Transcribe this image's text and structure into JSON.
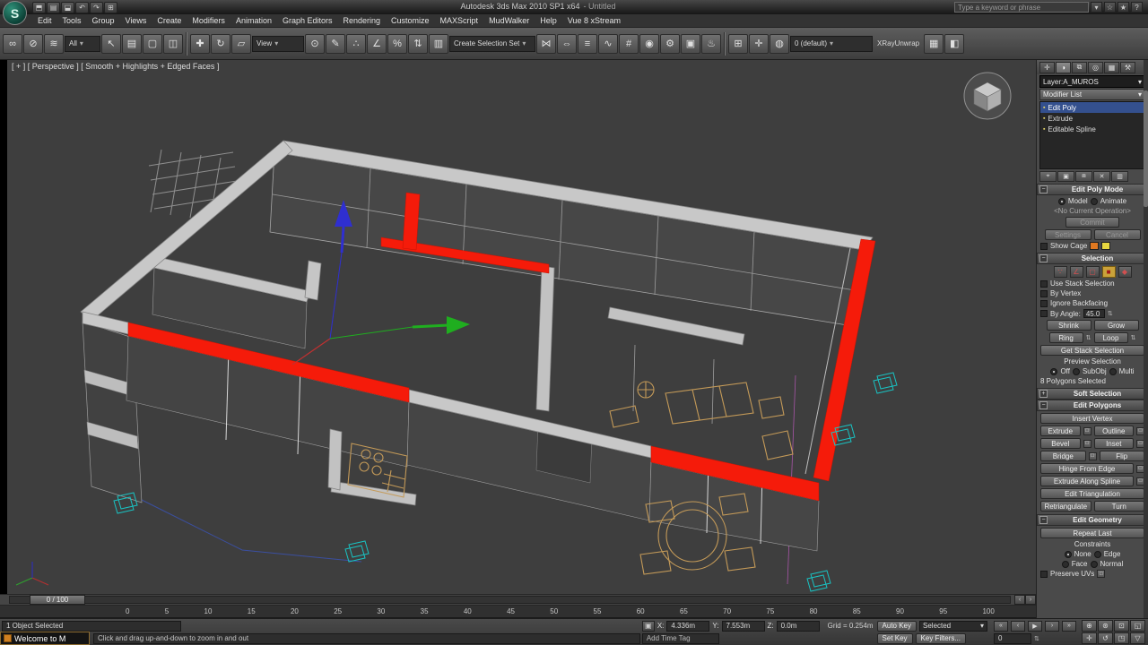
{
  "colors": {
    "selection_red": "#f51b0a",
    "gizmo_blue": "#2f2fd0",
    "gizmo_green": "#1fae1f",
    "wall_gray": "#c8c8c8",
    "furniture_tan": "#c49a58",
    "helper_teal": "#19c3c3",
    "viewport_bg": "#3e3e3e",
    "panel_bg": "#4a4a4a",
    "cage_swatch_orange": "#e07820",
    "cage_swatch_yellow": "#e8d840"
  },
  "icons": {
    "dropdown_arrow": "▾",
    "spinner": "⇅",
    "collapse": "−",
    "expand": "+",
    "mini_settings": "□",
    "lock": "▣",
    "logo_letter": "S",
    "slider_left": "‹",
    "slider_right": "›"
  },
  "titlebar": {
    "title": "Autodesk 3ds Max 2010 SP1 x64",
    "doc": "- Untitled"
  },
  "qat": {
    "icons": [
      {
        "name": "new-scene-icon",
        "glyph": "⬒"
      },
      {
        "name": "open-file-icon",
        "glyph": "▤"
      },
      {
        "name": "save-file-icon",
        "glyph": "⬓"
      },
      {
        "name": "undo-icon",
        "glyph": "↶"
      },
      {
        "name": "redo-icon",
        "glyph": "↷"
      },
      {
        "name": "project-folder-icon",
        "glyph": "⊞"
      }
    ]
  },
  "infocenter": {
    "placeholder": "Type a keyword or phrase",
    "icons": [
      {
        "name": "search-icon",
        "glyph": "▾"
      },
      {
        "name": "communication-center-icon",
        "glyph": "☆"
      },
      {
        "name": "favorites-icon",
        "glyph": "★"
      },
      {
        "name": "help-icon",
        "glyph": "?"
      }
    ]
  },
  "menubar": {
    "items": [
      "Edit",
      "Tools",
      "Group",
      "Views",
      "Create",
      "Modifiers",
      "Animation",
      "Graph Editors",
      "Rendering",
      "Customize",
      "MAXScript",
      "MudWalker",
      "Help",
      "Vue 8 xStream"
    ]
  },
  "toolbar": {
    "filter_dropdown": "All",
    "view_dropdown": "View",
    "selection_set_dropdown": "Create Selection Set",
    "layer_dropdown": "0 (default)",
    "xray_label": "XRayUnwrap",
    "icons_link": [
      {
        "name": "select-and-link-icon",
        "glyph": "∞"
      },
      {
        "name": "unlink-selection-icon",
        "glyph": "⊘"
      },
      {
        "name": "bind-to-spacewarp-icon",
        "glyph": "≋"
      }
    ],
    "icons_select": [
      {
        "name": "select-object-icon",
        "glyph": "↖"
      },
      {
        "name": "select-by-name-icon",
        "glyph": "▤"
      },
      {
        "name": "rectangular-region-icon",
        "glyph": "▢"
      },
      {
        "name": "window-crossing-icon",
        "glyph": "◫"
      }
    ],
    "icons_transform": [
      {
        "name": "select-and-move-icon",
        "glyph": "✚"
      },
      {
        "name": "select-and-rotate-icon",
        "glyph": "↻"
      },
      {
        "name": "select-and-scale-icon",
        "glyph": "▱"
      }
    ],
    "icons_snap": [
      {
        "name": "use-center-icon",
        "glyph": "⊙"
      },
      {
        "name": "select-and-manipulate-icon",
        "glyph": "✎"
      },
      {
        "name": "snap-toggle-icon",
        "glyph": "∴"
      },
      {
        "name": "angle-snap-icon",
        "glyph": "∠"
      },
      {
        "name": "percent-snap-icon",
        "glyph": "%"
      },
      {
        "name": "spinner-snap-icon",
        "glyph": "⇅"
      },
      {
        "name": "named-selection-sets-icon",
        "glyph": "▥"
      }
    ],
    "icons_tools": [
      {
        "name": "mirror-icon",
        "glyph": "⋈"
      },
      {
        "name": "align-icon",
        "glyph": "⇔"
      },
      {
        "name": "layer-manager-icon",
        "glyph": "≡"
      },
      {
        "name": "curve-editor-icon",
        "glyph": "∿"
      },
      {
        "name": "schematic-view-icon",
        "glyph": "#"
      },
      {
        "name": "material-editor-icon",
        "glyph": "◉"
      },
      {
        "name": "render-setup-icon",
        "glyph": "⚙"
      },
      {
        "name": "rendered-frame-icon",
        "glyph": "▣"
      },
      {
        "name": "render-production-icon",
        "glyph": "♨"
      }
    ],
    "icons_right": [
      {
        "name": "layers-toolbar-icon",
        "glyph": "⊞"
      },
      {
        "name": "create-layer-icon",
        "glyph": "✛"
      },
      {
        "name": "xview-icon",
        "glyph": "◍"
      }
    ],
    "icons_right2": [
      {
        "name": "unwrap-tool-icon",
        "glyph": "▦"
      },
      {
        "name": "unwrap-options-icon",
        "glyph": "◧"
      }
    ]
  },
  "viewport": {
    "label": "[ + ] [ Perspective ] [ Smooth + Highlights + Edged Faces ]",
    "time_slider": "0 / 100"
  },
  "command_panel": {
    "tabs": [
      {
        "name": "tab-create",
        "glyph": "✛"
      },
      {
        "name": "tab-modify",
        "glyph": "◑",
        "active": true
      },
      {
        "name": "tab-hierarchy",
        "glyph": "⧉"
      },
      {
        "name": "tab-motion",
        "glyph": "◎"
      },
      {
        "name": "tab-display",
        "glyph": "▦"
      },
      {
        "name": "tab-utilities",
        "glyph": "⚒"
      }
    ],
    "layer_field": "Layer:A_MUROS",
    "modifier_list": "Modifier List",
    "stack": [
      {
        "label": "Edit Poly",
        "icon": "▪",
        "selected": true
      },
      {
        "label": "Extrude",
        "icon": "▪"
      },
      {
        "label": "Editable Spline",
        "icon": "▪"
      }
    ],
    "stack_buttons": [
      {
        "name": "pin-stack-icon",
        "glyph": "⌖"
      },
      {
        "name": "show-end-result-icon",
        "glyph": "▣"
      },
      {
        "name": "make-unique-icon",
        "glyph": "⧈"
      },
      {
        "name": "remove-modifier-icon",
        "glyph": "✕"
      },
      {
        "name": "configure-modifier-sets-icon",
        "glyph": "▥"
      }
    ],
    "rollouts": {
      "edit_poly_mode": {
        "title": "Edit Poly Mode",
        "radio_model": "Model",
        "radio_animate": "Animate",
        "operation": "<No Current Operation>",
        "commit": "Commit",
        "settings": "Settings",
        "cancel": "Cancel",
        "show_cage": "Show Cage"
      },
      "selection": {
        "title": "Selection",
        "subobject_icons": [
          {
            "name": "vertex-mode-icon",
            "glyph": "∵"
          },
          {
            "name": "edge-mode-icon",
            "glyph": "∠"
          },
          {
            "name": "border-mode-icon",
            "glyph": "▢"
          },
          {
            "name": "polygon-mode-icon",
            "glyph": "■",
            "active": true
          },
          {
            "name": "element-mode-icon",
            "glyph": "◆"
          }
        ],
        "use_stack_selection": "Use Stack Selection",
        "by_vertex": "By Vertex",
        "ignore_backfacing": "Ignore Backfacing",
        "by_angle": "By Angle:",
        "by_angle_value": "45.0",
        "shrink": "Shrink",
        "grow": "Grow",
        "ring": "Ring",
        "loop": "Loop",
        "get_stack_selection": "Get Stack Selection",
        "preview_selection": "Preview Selection",
        "off": "Off",
        "subobj": "SubObj",
        "multi": "Multi",
        "status": "8 Polygons Selected"
      },
      "soft_selection": {
        "title": "Soft Selection"
      },
      "edit_polygons": {
        "title": "Edit Polygons",
        "insert_vertex": "Insert Vertex",
        "extrude": "Extrude",
        "outline": "Outline",
        "bevel": "Bevel",
        "inset": "Inset",
        "bridge": "Bridge",
        "flip": "Flip",
        "hinge_from_edge": "Hinge From Edge",
        "extrude_along_spline": "Extrude Along Spline",
        "edit_triangulation": "Edit Triangulation",
        "retriangulate": "Retriangulate",
        "turn": "Turn"
      },
      "edit_geometry": {
        "title": "Edit Geometry",
        "repeat_last": "Repeat Last",
        "constraints": "Constraints",
        "none": "None",
        "edge": "Edge",
        "face": "Face",
        "normal": "Normal",
        "preserve_uvs": "Preserve UVs"
      }
    }
  },
  "timeline": {
    "ticks": [
      "0",
      "5",
      "10",
      "15",
      "20",
      "25",
      "30",
      "35",
      "40",
      "45",
      "50",
      "55",
      "60",
      "65",
      "70",
      "75",
      "80",
      "85",
      "90",
      "95",
      "100"
    ]
  },
  "statusbar": {
    "selected": "1 Object Selected",
    "prompt": "Click and drag up-and-down to zoom in and out",
    "welcome": "Welcome to M",
    "x_label": "X:",
    "x_value": "4.336m",
    "y_label": "Y:",
    "y_value": "7.553m",
    "z_label": "Z:",
    "z_value": "0.0m",
    "grid": "Grid = 0.254m",
    "add_time_tag": "Add Time Tag",
    "auto_key": "Auto Key",
    "selected_dropdown": "Selected",
    "set_key": "Set Key",
    "key_filters": "Key Filters...",
    "frame": "0",
    "playback": [
      {
        "name": "go-to-start-button",
        "glyph": "«"
      },
      {
        "name": "previous-frame-button",
        "glyph": "‹"
      },
      {
        "name": "play-button",
        "glyph": "▶"
      },
      {
        "name": "next-frame-button",
        "glyph": "›"
      },
      {
        "name": "go-to-end-button",
        "glyph": "»"
      }
    ],
    "nav_icons": [
      {
        "name": "zoom-icon",
        "glyph": "⊕"
      },
      {
        "name": "zoom-all-icon",
        "glyph": "⊛"
      },
      {
        "name": "zoom-extents-icon",
        "glyph": "⊡"
      },
      {
        "name": "zoom-region-icon",
        "glyph": "◱"
      },
      {
        "name": "pan-icon",
        "glyph": "✛"
      },
      {
        "name": "orbit-icon",
        "glyph": "↺"
      },
      {
        "name": "maximize-viewport-icon",
        "glyph": "◳"
      },
      {
        "name": "field-of-view-icon",
        "glyph": "▽"
      }
    ]
  }
}
